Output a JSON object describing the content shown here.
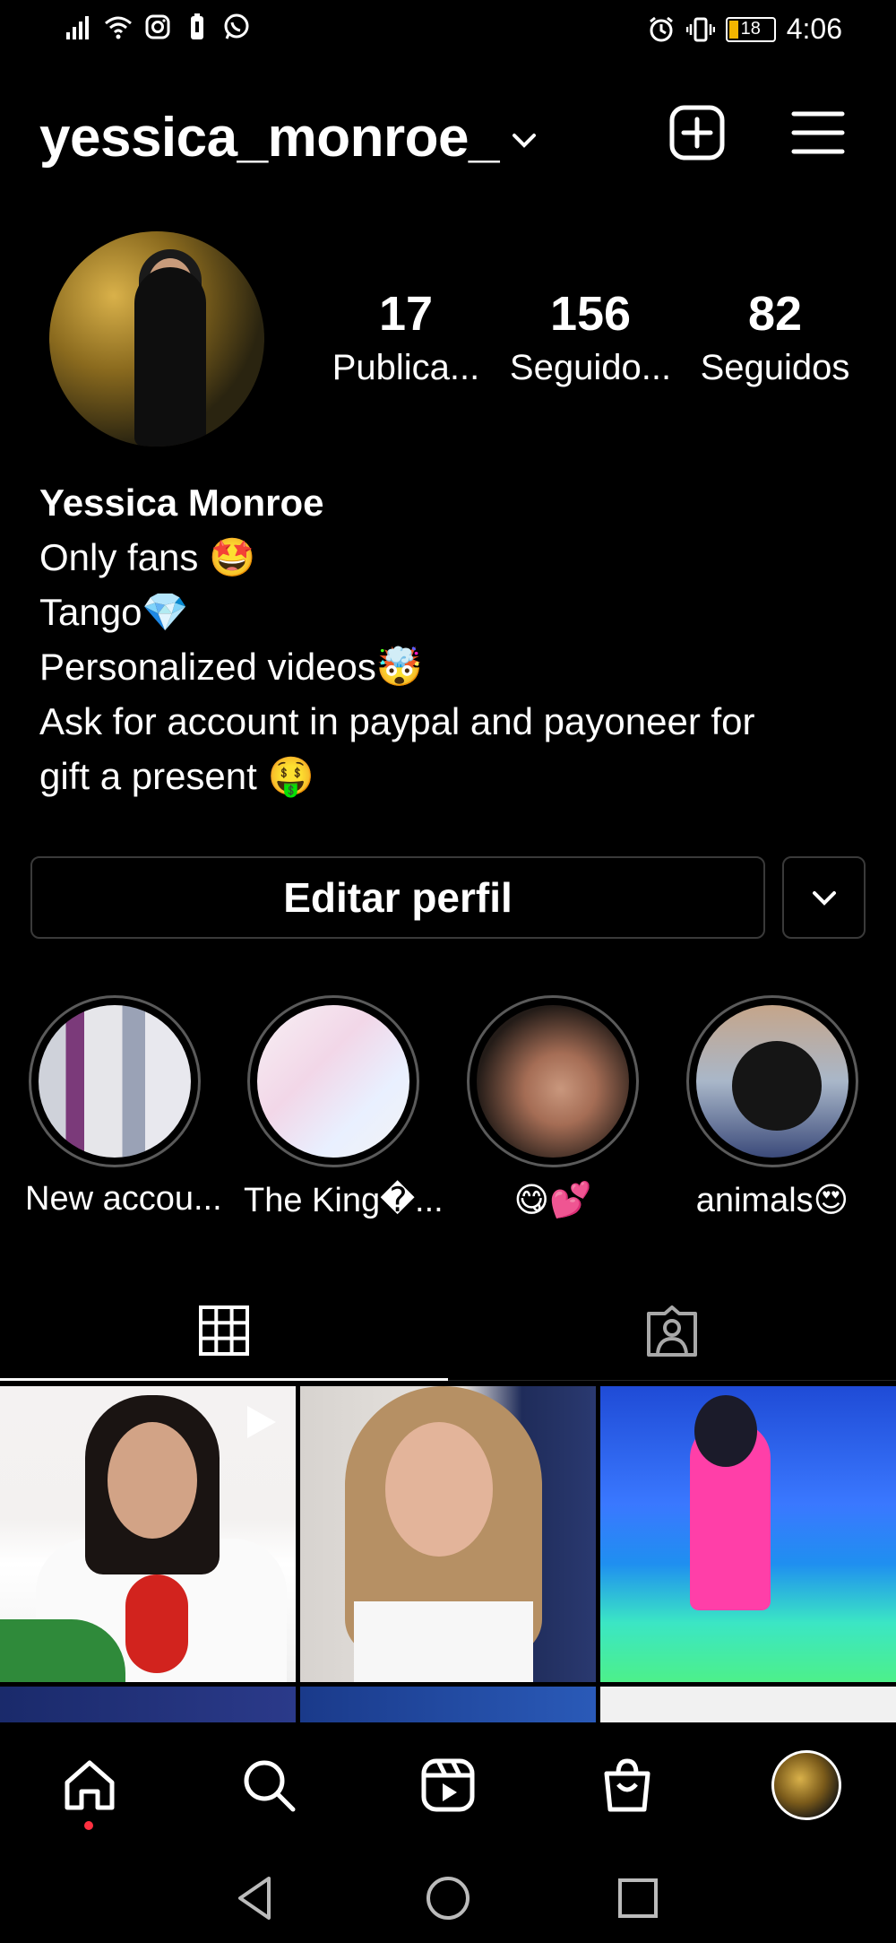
{
  "status_bar": {
    "time": "4:06",
    "battery_level": "18",
    "icons_left": [
      "signal-icon",
      "wifi-icon",
      "instagram-icon",
      "battery-saver-icon",
      "whatsapp-icon"
    ],
    "icons_right": [
      "alarm-icon",
      "vibrate-icon",
      "battery-icon"
    ]
  },
  "header": {
    "username": "yessica_monroe_",
    "create_icon": "plus-square-icon",
    "menu_icon": "hamburger-menu-icon"
  },
  "profile": {
    "stats": [
      {
        "value": "17",
        "label": "Publica..."
      },
      {
        "value": "156",
        "label": "Seguido..."
      },
      {
        "value": "82",
        "label": "Seguidos"
      }
    ],
    "display_name": "Yessica Monroe",
    "bio_lines": [
      "Only fans 🤩",
      "Tango💎",
      "Personalized videos🤯",
      "Ask for account in paypal and payoneer for",
      "gift a present 🤑"
    ]
  },
  "actions": {
    "edit_profile_label": "Editar perfil"
  },
  "highlights": [
    {
      "label": "New accou..."
    },
    {
      "label": "The King�..."
    },
    {
      "label": "😋💕"
    },
    {
      "label": "animals😍"
    }
  ],
  "tabs": [
    {
      "name": "grid",
      "icon": "grid-icon",
      "active": true
    },
    {
      "name": "tagged",
      "icon": "tagged-person-icon",
      "active": false
    }
  ],
  "bottom_nav": [
    "home-icon",
    "search-icon",
    "reels-icon",
    "shop-icon",
    "profile-avatar"
  ],
  "colors": {
    "background": "#000000",
    "notification_dot": "#ff3040",
    "border": "#3a3a3a"
  }
}
